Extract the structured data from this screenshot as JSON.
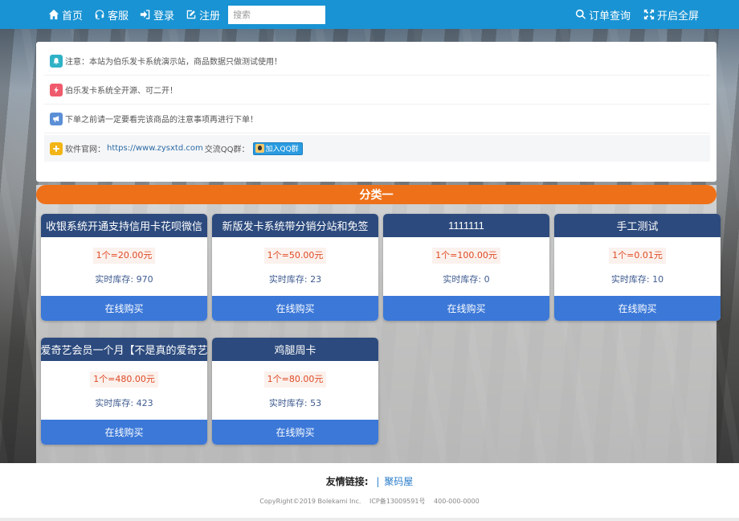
{
  "nav": {
    "home": "首页",
    "service": "客服",
    "login": "登录",
    "register": "注册",
    "search_placeholder": "搜索",
    "order_query": "订单查询",
    "fullscreen": "开启全屏"
  },
  "notices": {
    "n1": "注意：本站为伯乐发卡系统演示站，商品数据只做测试使用！",
    "n2": "伯乐发卡系统全开源、可二开！",
    "n3": "下单之前请一定要看完该商品的注意事项再进行下单！",
    "n4_label": "软件官网：",
    "n4_link": "https://www.zysxtd.com",
    "n4_qq": "交流QQ群：",
    "n4_qq_btn": "加入QQ群",
    "colors": {
      "n1": "#2fb2c6",
      "n2": "#ef5a6d",
      "n3": "#5b8fd6",
      "n4": "#f3b515"
    }
  },
  "category": {
    "title": "分类一",
    "color": "#ee7119"
  },
  "products": [
    {
      "title": "收银系统开通支持信用卡花呗微信",
      "price": "1个=20.00元",
      "stock_label": "实时库存:",
      "stock": "970",
      "buy": "在线购买"
    },
    {
      "title": "新版发卡系统带分销分站和免签",
      "price": "1个=50.00元",
      "stock_label": "实时库存:",
      "stock": "23",
      "buy": "在线购买"
    },
    {
      "title": "1111111",
      "price": "1个=100.00元",
      "stock_label": "实时库存:",
      "stock": "0",
      "buy": "在线购买"
    },
    {
      "title": "手工测试",
      "price": "1个=0.01元",
      "stock_label": "实时库存:",
      "stock": "10",
      "buy": "在线购买"
    },
    {
      "title": "爱奇艺会员一个月【不是真的爱奇艺",
      "price": "1个=480.00元",
      "stock_label": "实时库存:",
      "stock": "423",
      "buy": "在线购买"
    },
    {
      "title": "鸡腿周卡",
      "price": "1个=80.00元",
      "stock_label": "实时库存:",
      "stock": "53",
      "buy": "在线购买"
    }
  ],
  "footer": {
    "friend_label": "友情链接:",
    "sep": "|",
    "friend_link": "聚码屋",
    "copyright": "CopyRight©2019 Bolekami Inc.",
    "icp": "ICP备13009591号",
    "phone": "400-000-0000"
  }
}
